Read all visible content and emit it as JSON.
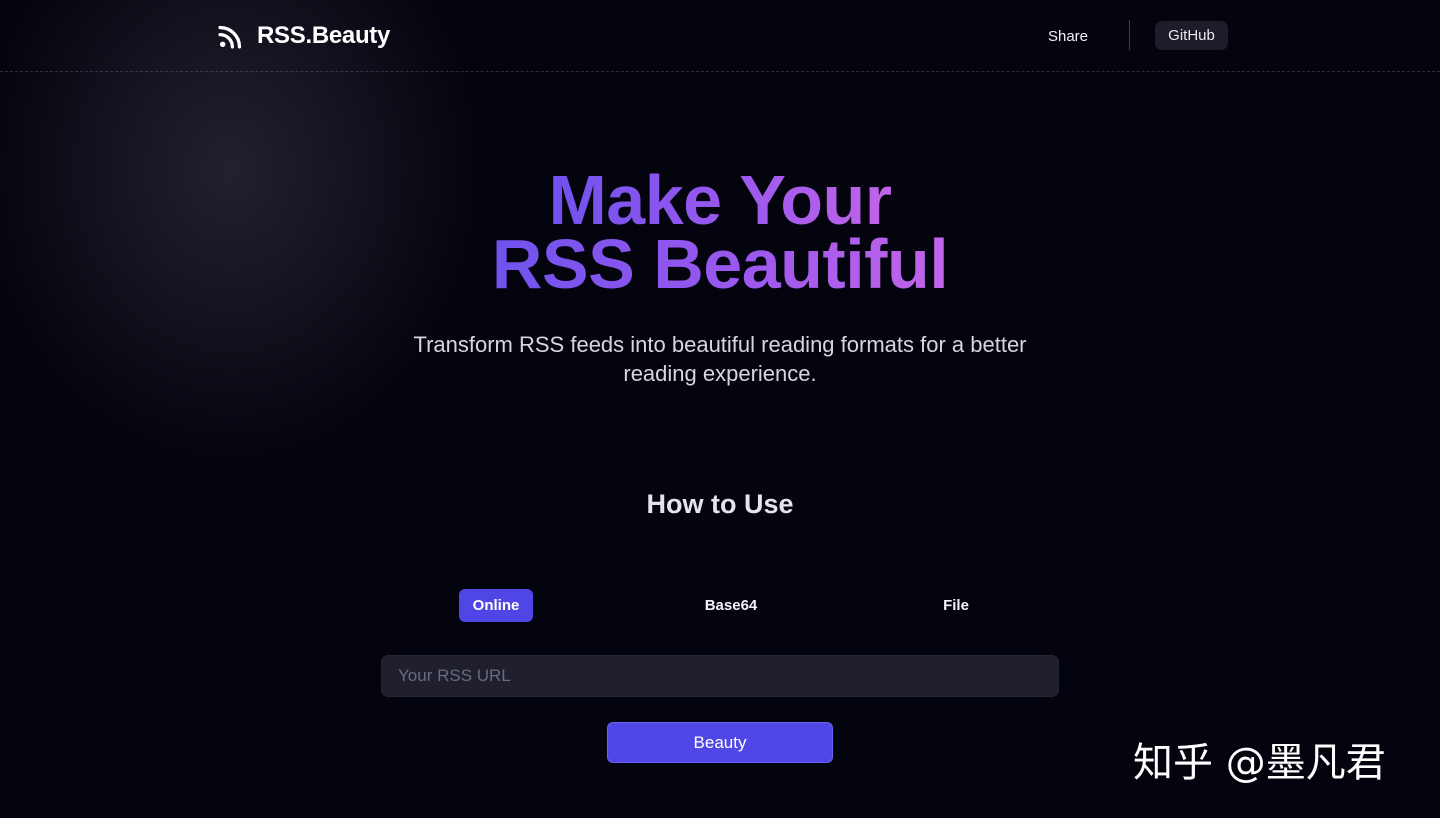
{
  "header": {
    "brand_name": "RSS.Beauty",
    "nav": {
      "share_label": "Share",
      "github_label": "GitHub"
    }
  },
  "hero": {
    "title_line1": "Make Your",
    "title_line2": "RSS Beautiful",
    "subtitle": "Transform RSS feeds into beautiful reading formats for a better reading experience."
  },
  "how_to_use": {
    "title": "How to Use",
    "tabs": [
      {
        "label": "Online",
        "active": true
      },
      {
        "label": "Base64",
        "active": false
      },
      {
        "label": "File",
        "active": false
      }
    ],
    "input": {
      "placeholder": "Your RSS URL",
      "value": ""
    },
    "submit_label": "Beauty"
  },
  "watermark": {
    "text": "知乎 @墨凡君"
  },
  "colors": {
    "background": "#04040f",
    "accent": "#4f46e5",
    "title_gradient_start": "#6f52ee",
    "title_gradient_end": "#c264e8",
    "input_background": "#1f1f2e"
  },
  "icons": {
    "brand": "rss-icon"
  }
}
